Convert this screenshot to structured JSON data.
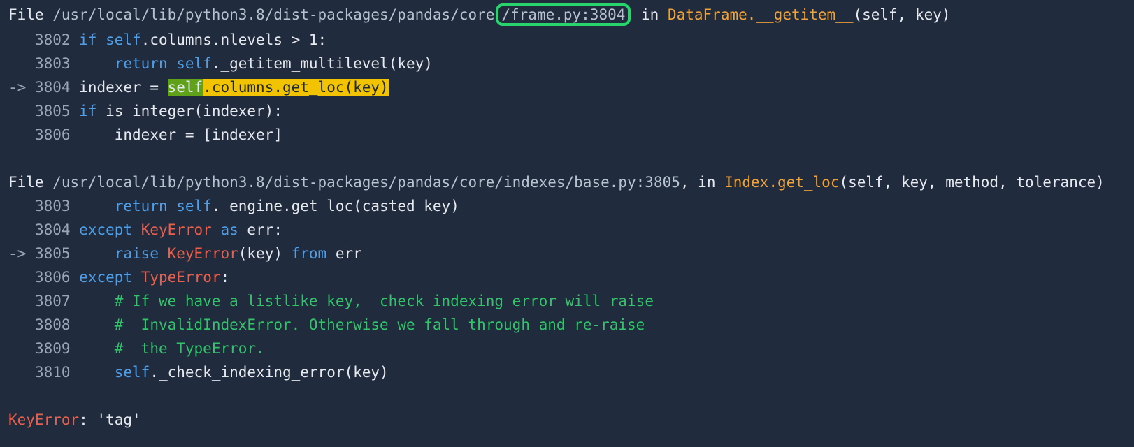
{
  "frame1": {
    "file_prefix": "File ",
    "path_start": "/usr/local/lib/python3.8/dist-packages/pandas/core",
    "path_highlight": "/frame.py:3804",
    "in_word": " in ",
    "func_name": "DataFrame.__getitem__",
    "func_args": "(self, key)",
    "lines": [
      {
        "marker": "   ",
        "num": "3802",
        "code_a_kw": "if ",
        "code_b_kw": "self",
        "code_c": ".columns.nlevels > 1:"
      },
      {
        "marker": "   ",
        "num": "3803",
        "code_a_kw": "    return ",
        "code_b_kw": "self",
        "code_c": "._getitem_multilevel(key)"
      },
      {
        "marker": "-> ",
        "num": "3804",
        "code_a": "indexer = ",
        "hl_green": "self",
        "hl_yellow": ".columns.get_loc(key)"
      },
      {
        "marker": "   ",
        "num": "3805",
        "code_a_kw": "if ",
        "code_c": "is_integer(indexer):"
      },
      {
        "marker": "   ",
        "num": "3806",
        "code_c": "    indexer = [indexer]"
      }
    ]
  },
  "frame2": {
    "file_prefix": "File ",
    "path": "/usr/local/lib/python3.8/dist-packages/pandas/core/indexes/base.py:3805",
    "comma_in": ", in ",
    "func_name": "Index.get_loc",
    "func_args": "(self, key, method, tolerance)",
    "lines": [
      {
        "marker": "   ",
        "num": "3803",
        "a_kw": "    return ",
        "b_kw": "self",
        "c": "._engine.get_loc(casted_key)"
      },
      {
        "marker": "   ",
        "num": "3804",
        "a_kw": "except ",
        "err": "KeyError",
        "b_kw": " as ",
        "c": "err:"
      },
      {
        "marker": "-> ",
        "num": "3805",
        "a_kw": "    raise ",
        "err": "KeyError",
        "c": "(key) ",
        "b_kw": "from",
        "d": " err"
      },
      {
        "marker": "   ",
        "num": "3806",
        "a_kw": "except ",
        "err": "TypeError",
        "c": ":"
      },
      {
        "marker": "   ",
        "num": "3807",
        "cm": "    # If we have a listlike key, _check_indexing_error will raise"
      },
      {
        "marker": "   ",
        "num": "3808",
        "cm": "    #  InvalidIndexError. Otherwise we fall through and re-raise"
      },
      {
        "marker": "   ",
        "num": "3809",
        "cm": "    #  the TypeError."
      },
      {
        "marker": "   ",
        "num": "3810",
        "a_kw": "    self",
        "c": "._check_indexing_error(key)"
      }
    ]
  },
  "final_error": {
    "type": "KeyError",
    "message": ": 'tag'"
  }
}
